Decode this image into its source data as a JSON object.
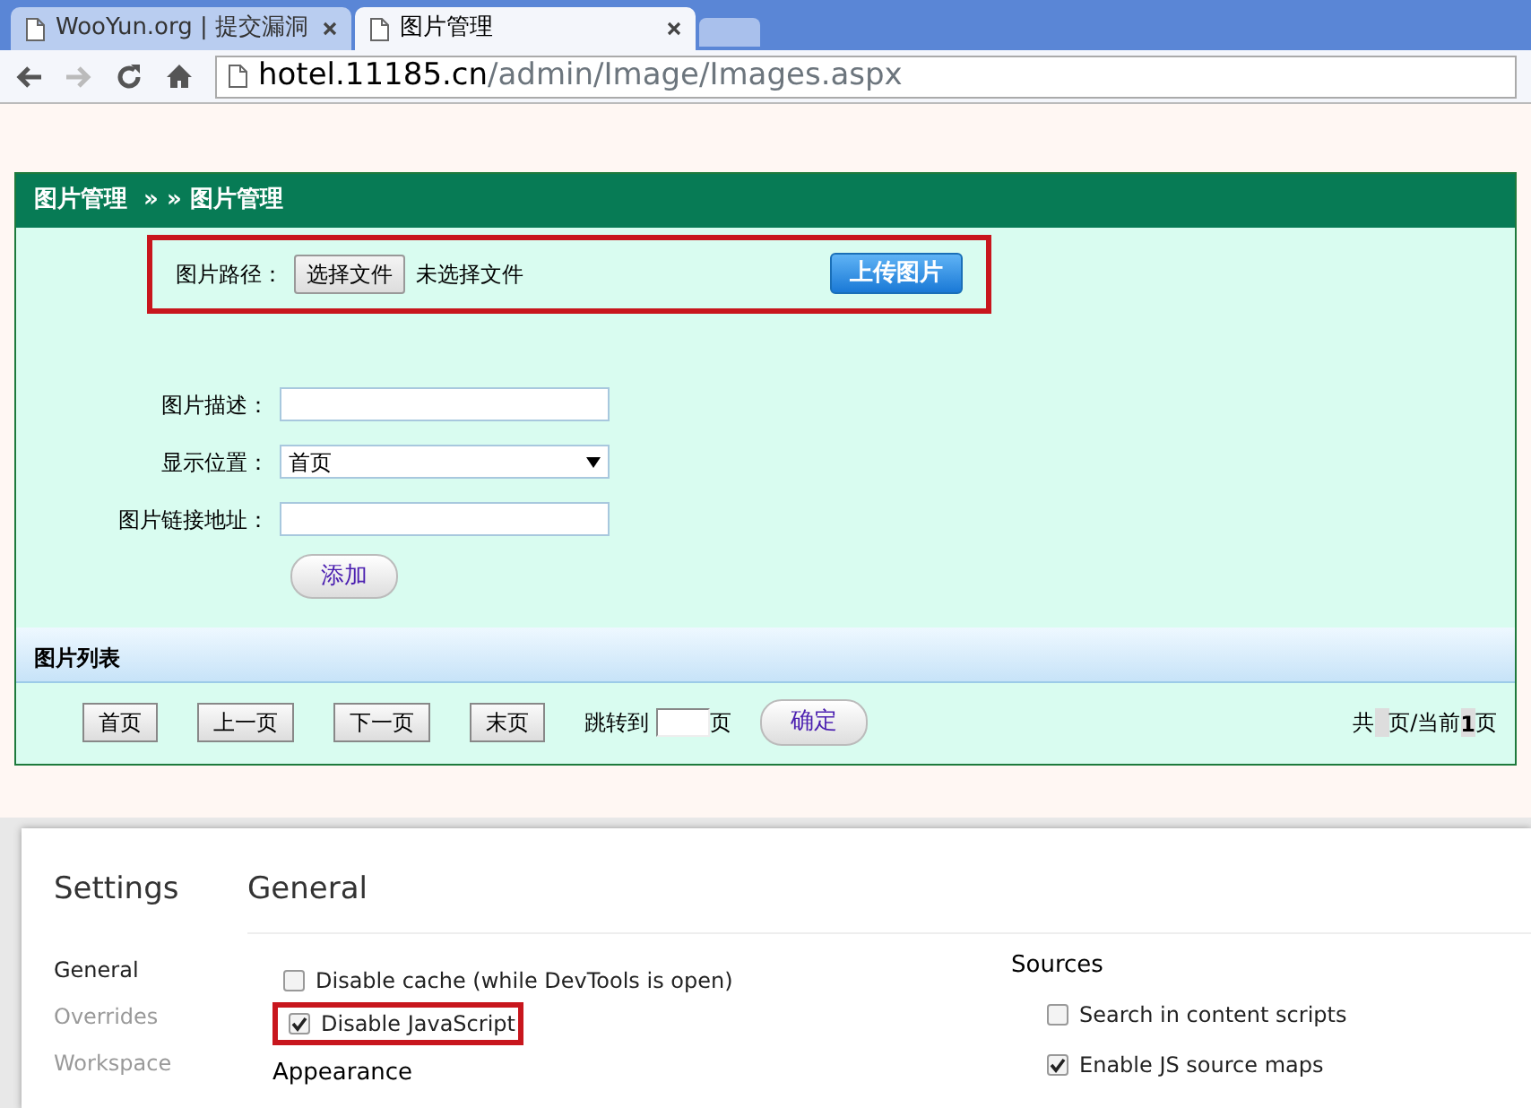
{
  "browser": {
    "tabs": [
      {
        "title": "WooYun.org | 提交漏洞",
        "selected": false
      },
      {
        "title": "图片管理",
        "selected": true
      }
    ],
    "address": {
      "host": "hotel.11185.cn",
      "path": "/admin/Image/Images.aspx"
    }
  },
  "panel": {
    "title": "图片管理  » » 图片管理",
    "upload": {
      "label": "图片路径：",
      "file_button": "选择文件",
      "file_status": "未选择文件",
      "upload_button": "上传图片",
      "highlighted": true
    },
    "fields": [
      {
        "kind": "text",
        "label": "图片描述："
      },
      {
        "kind": "select",
        "label": "显示位置：",
        "value": "首页"
      },
      {
        "kind": "text",
        "label": "图片链接地址："
      }
    ],
    "add_button": "添加",
    "list_title": "图片列表",
    "pager": {
      "buttons": [
        "首页",
        "上一页",
        "下一页",
        "末页"
      ],
      "jump_label": "跳转到",
      "jump_suffix": "页",
      "ok_button": "确定",
      "info": {
        "prefix": "共",
        "middle": "页/当前",
        "current": "1",
        "suffix": "页"
      }
    }
  },
  "settings": {
    "title": "Settings",
    "menu": [
      {
        "label": "General",
        "selected": true
      },
      {
        "label": "Overrides",
        "selected": false
      },
      {
        "label": "Workspace",
        "selected": false
      }
    ],
    "heading": "General",
    "options": [
      {
        "label": "Disable cache (while DevTools is open)",
        "checked": false,
        "highlighted": false
      },
      {
        "label": "Disable JavaScript",
        "checked": true,
        "highlighted": true
      }
    ],
    "appearance": "Appearance",
    "sources_title": "Sources",
    "sources": [
      {
        "label": "Search in content scripts",
        "checked": false
      },
      {
        "label": "Enable JS source maps",
        "checked": true
      }
    ]
  }
}
